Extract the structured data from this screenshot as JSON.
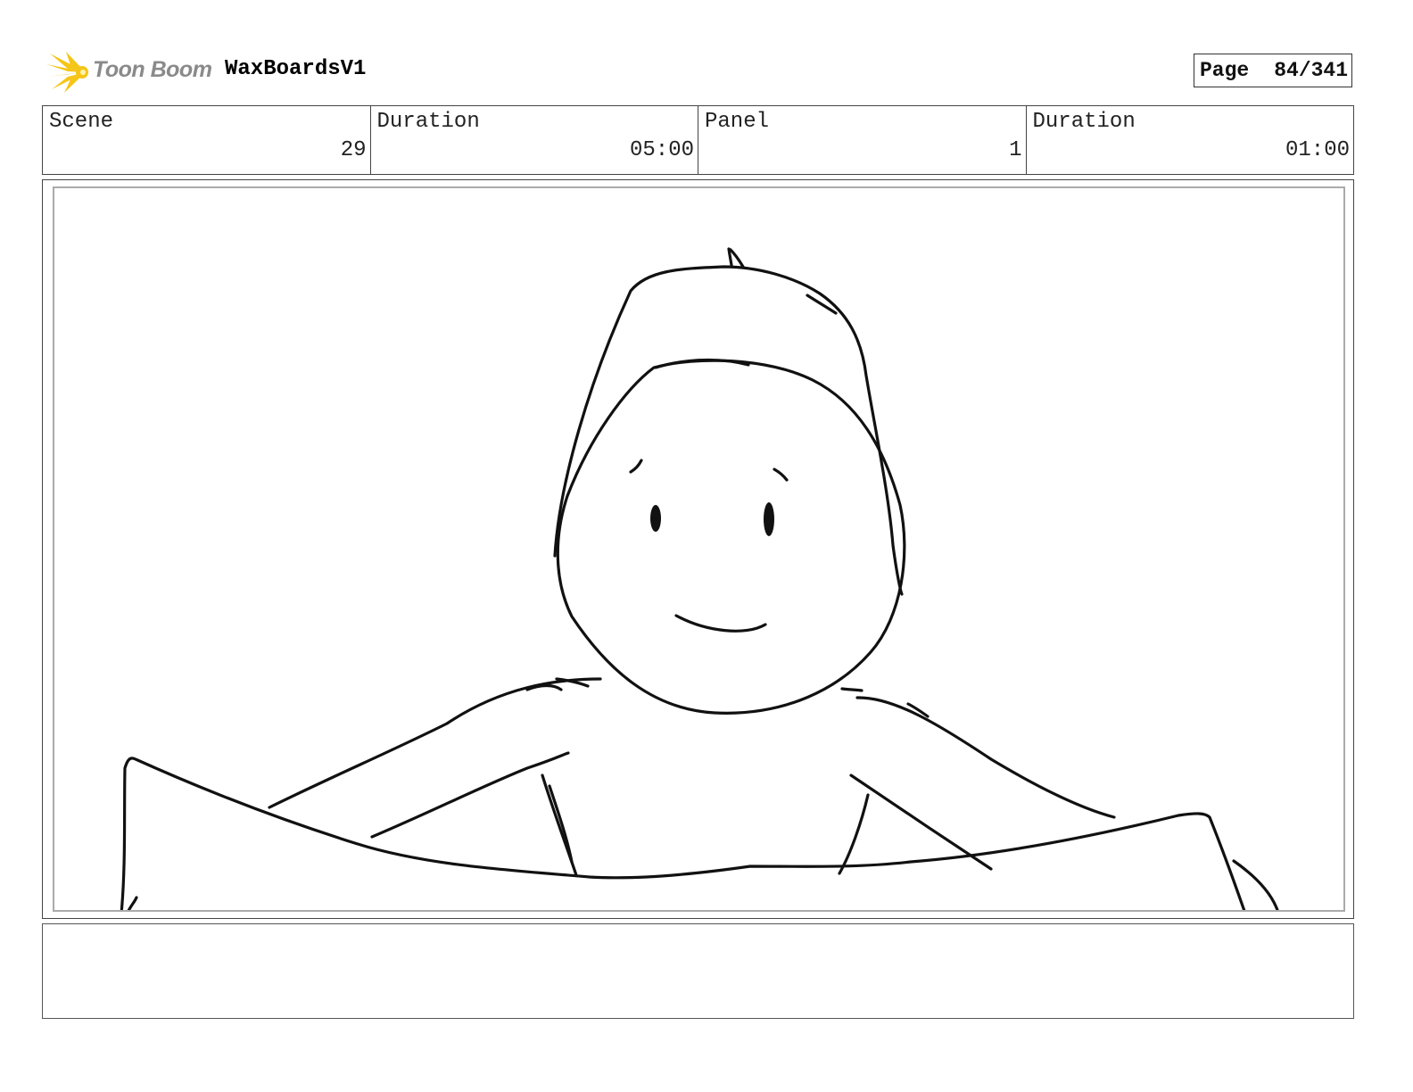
{
  "header": {
    "logo_text": "Toon Boom",
    "project_title": "WaxBoardsV1",
    "page_label": "Page",
    "page_value": "84/341"
  },
  "info": {
    "scene_label": "Scene",
    "scene_value": "29",
    "scene_duration_label": "Duration",
    "scene_duration_value": "05:00",
    "panel_label": "Panel",
    "panel_value": "1",
    "panel_duration_label": "Duration",
    "panel_duration_value": "01:00"
  },
  "colors": {
    "logo_burst": "#f5c518",
    "logo_text": "#8a8a8a",
    "sketch_ink": "#111111"
  },
  "notes": ""
}
